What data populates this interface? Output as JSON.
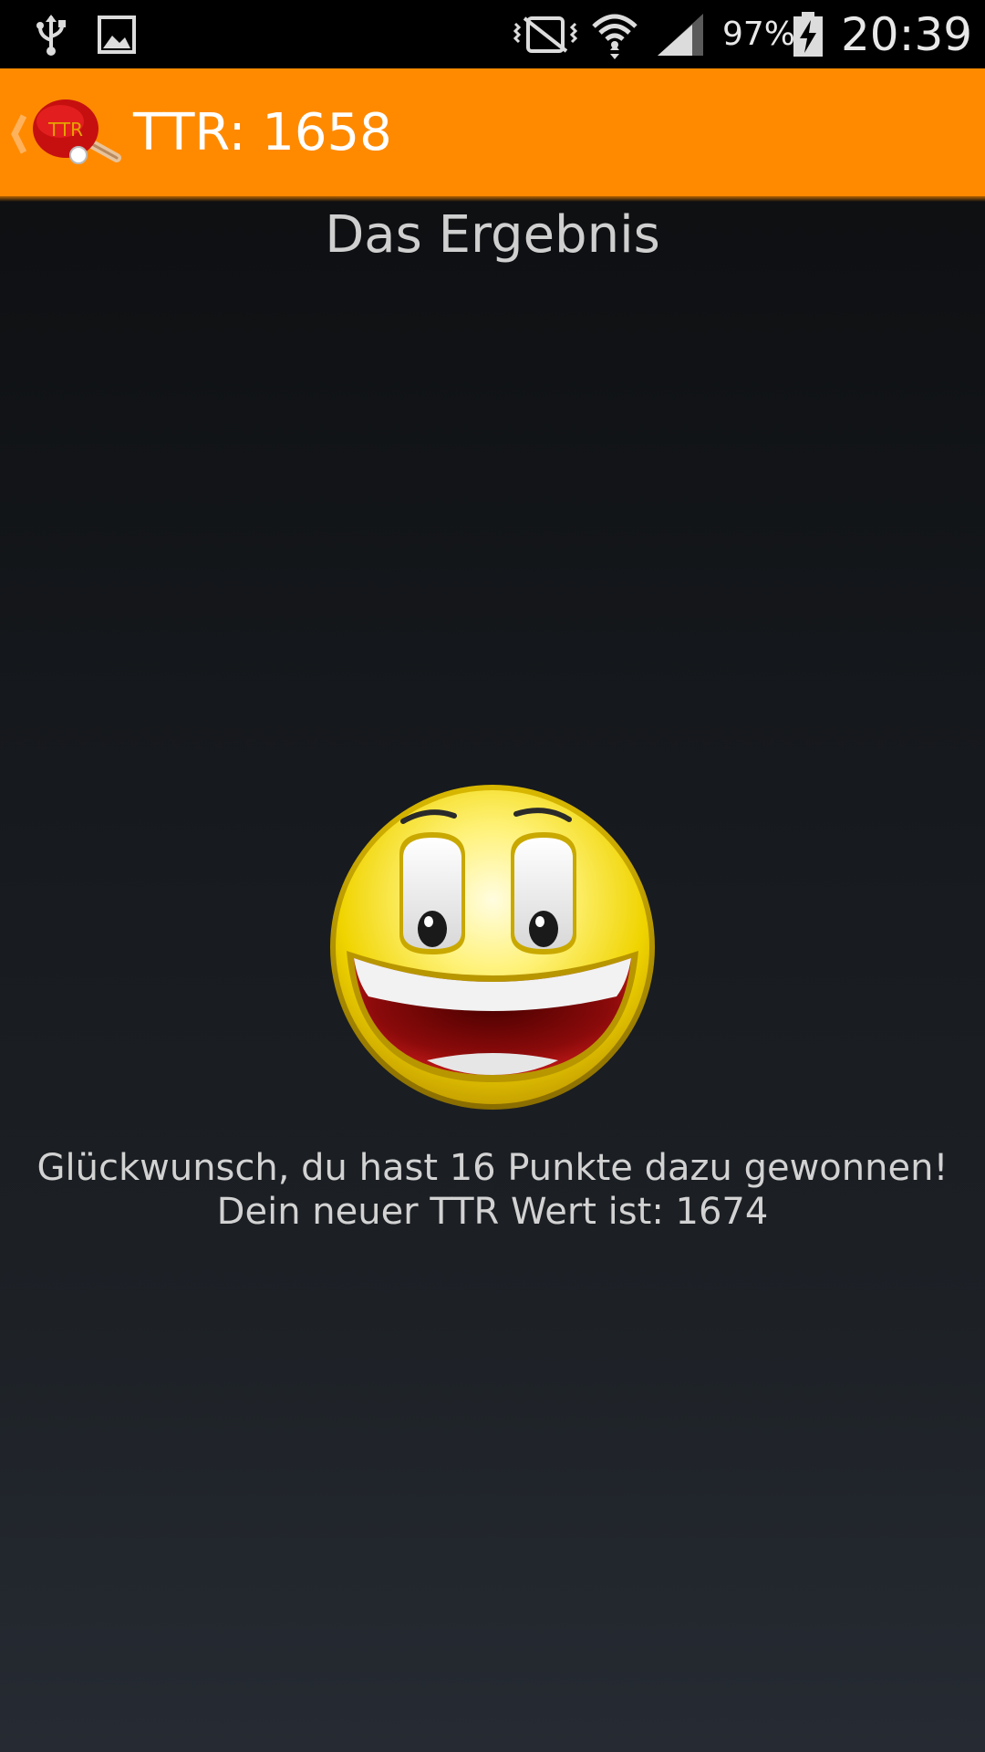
{
  "status_bar": {
    "battery_percent": "97%",
    "time": "20:39",
    "icons": [
      "usb-icon",
      "image-notification-icon",
      "vibrate-icon",
      "wifi-icon",
      "signal-icon",
      "battery-charging-icon"
    ]
  },
  "action_bar": {
    "title": "TTR: 1658",
    "background_color": "#ff8a00",
    "logo_text": "TTR"
  },
  "content": {
    "heading": "Das Ergebnis",
    "message_line1": "Glückwunsch, du hast 16 Punkte dazu gewonnen!",
    "message_line2": "Dein neuer TTR Wert ist: 1674",
    "image": "laughing-smiley"
  }
}
